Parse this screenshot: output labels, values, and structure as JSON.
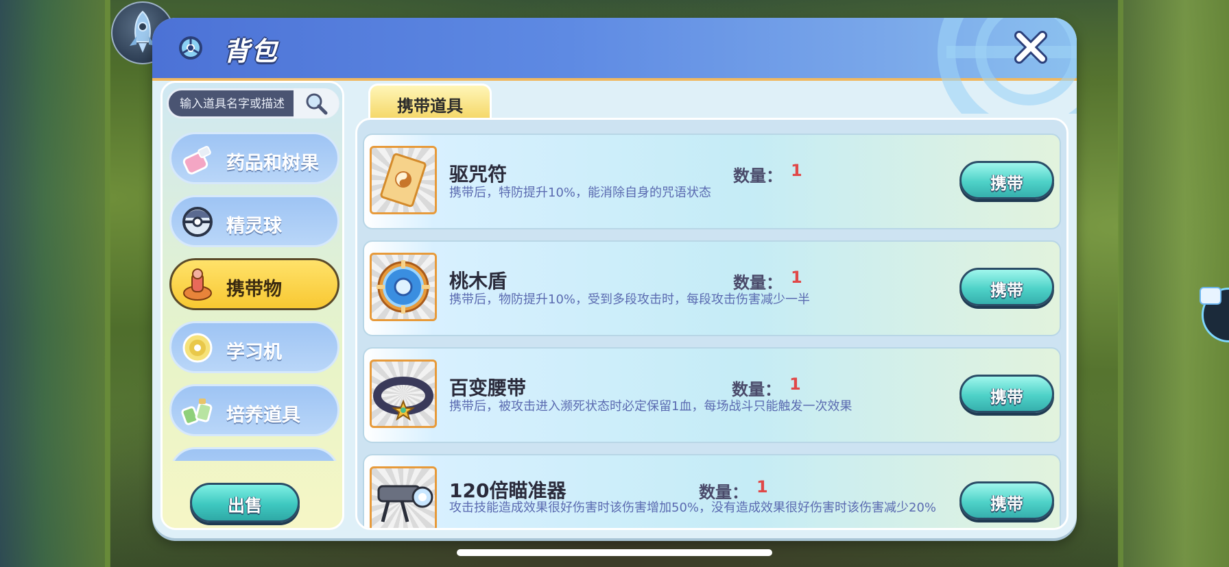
{
  "header": {
    "title": "背包"
  },
  "search": {
    "placeholder": "输入道具名字或描述"
  },
  "categories": [
    {
      "label": "药品和树果",
      "icon": "potion-icon",
      "active": false
    },
    {
      "label": "精灵球",
      "icon": "pokeball-icon",
      "active": false
    },
    {
      "label": "携带物",
      "icon": "held-item-icon",
      "active": true
    },
    {
      "label": "学习机",
      "icon": "disc-icon",
      "active": false
    },
    {
      "label": "培养道具",
      "icon": "training-item-icon",
      "active": false
    }
  ],
  "sell_label": "出售",
  "tab_label": "携带道具",
  "qty_label": "数量：",
  "items": [
    {
      "name": "驱咒符",
      "qty": "1",
      "desc": "携带后，特防提升10%，能消除自身的咒语状态",
      "button": "携带",
      "icon": "talisman-icon"
    },
    {
      "name": "桃木盾",
      "qty": "1",
      "desc": "携带后，物防提升10%，受到多段攻击时，每段攻击伤害减少一半",
      "button": "携带",
      "icon": "shield-icon"
    },
    {
      "name": "百变腰带",
      "qty": "1",
      "desc": "携带后，被攻击进入濒死状态时必定保留1血，每场战斗只能触发一次效果",
      "button": "携带",
      "icon": "belt-icon"
    },
    {
      "name": "120倍瞄准器",
      "qty": "1",
      "desc": "攻击技能造成效果很好伤害时该伤害增加50%，没有造成效果很好伤害时该伤害减少20%",
      "button": "携带",
      "icon": "scope-icon"
    }
  ],
  "colors": {
    "accent_header": "#4c72d6",
    "active_tab": "#f8c832",
    "qty_value": "#e04848",
    "button_teal": "#4ed2c8"
  }
}
